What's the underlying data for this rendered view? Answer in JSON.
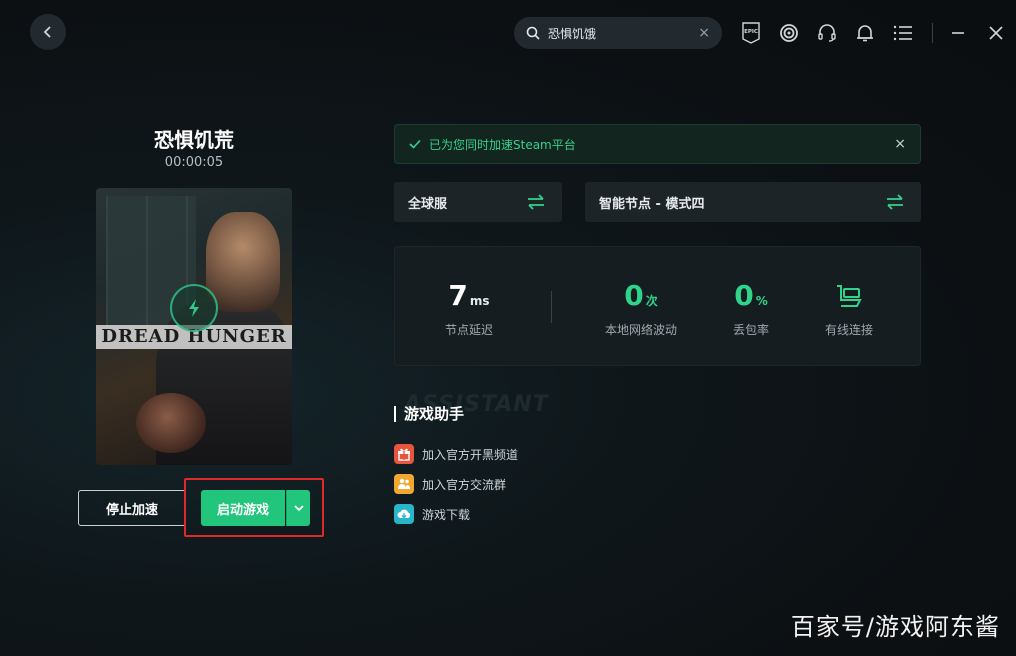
{
  "topbar": {
    "search": {
      "value": "恐惧饥饿",
      "clear": "×"
    },
    "icons": [
      "back-icon",
      "epic-games-icon",
      "uplay-icon",
      "headset-icon",
      "bell-icon",
      "menu-icon",
      "minimize-icon",
      "close-icon"
    ],
    "epic_label": "EPIC"
  },
  "game": {
    "title": "恐惧饥荒",
    "timer": "00:00:05",
    "cover_logo": "DREAD HUNGER"
  },
  "actions": {
    "stop_label": "停止加速",
    "launch_label": "启动游戏"
  },
  "notice": {
    "text": "已为您同时加速Steam平台",
    "close": "×"
  },
  "selectors": {
    "server": "全球服",
    "node": "智能节点 - 模式四"
  },
  "stats": {
    "latency": {
      "value": "7",
      "unit": "ms",
      "caption": "节点延迟"
    },
    "fluctuation": {
      "value": "0",
      "unit": "次",
      "caption": "本地网络波动"
    },
    "packet_loss": {
      "value": "0",
      "unit": "%",
      "caption": "丢包率"
    },
    "connection": {
      "caption": "有线连接"
    }
  },
  "assistant": {
    "bg_text": "ASSISTANT",
    "title": "游戏助手",
    "items": [
      {
        "label": "加入官方开黑频道",
        "icon": "gift-icon",
        "color": "#e8553e"
      },
      {
        "label": "加入官方交流群",
        "icon": "group-icon",
        "color": "#f0a830"
      },
      {
        "label": "游戏下载",
        "icon": "cloud-download-icon",
        "color": "#27b5c9"
      }
    ]
  },
  "watermark": "百家号/游戏阿东酱",
  "colors": {
    "accent": "#22c57c",
    "highlight_box": "#e02a2a",
    "notice_text": "#37d08f"
  }
}
